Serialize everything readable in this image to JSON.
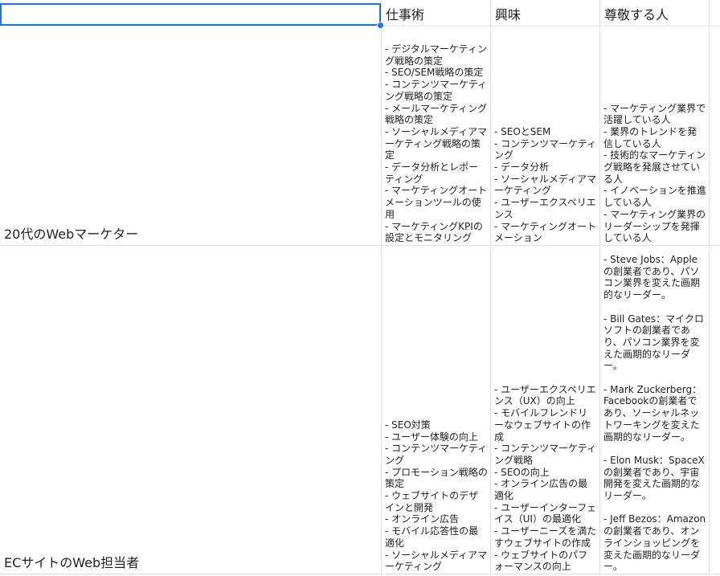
{
  "headers": {
    "a": "",
    "b": "仕事術",
    "c": "興味",
    "d": "尊敬する人"
  },
  "rows": [
    {
      "label": "20代のWebマーケター",
      "b": [
        "- デジタルマーケティング戦略の策定",
        "- SEO/SEM戦略の策定",
        "- コンテンツマーケティング戦略の策定",
        "- メールマーケティング戦略の策定",
        "- ソーシャルメディアマーケティング戦略の策定",
        "- データ分析とレポーティング",
        "- マーケティングオートメーションツールの使用",
        "- マーケティングKPIの設定とモニタリング"
      ],
      "c": [
        "- SEOとSEM",
        "- コンテンツマーケティング",
        "- データ分析",
        "- ソーシャルメディアマーケティング",
        "- ユーザーエクスペリエンス",
        "- マーケティングオートメーション"
      ],
      "d": [
        "- マーケティング業界で活躍している人",
        "- 業界のトレンドを発信している人",
        "- 技術的なマーケティング戦略を発展させている人",
        "- イノベーションを推進している人",
        "- マーケティング業界のリーダーシップを発揮している人"
      ]
    },
    {
      "label": "ECサイトのWeb担当者",
      "b": [
        "- SEO対策",
        "- ユーザー体験の向上",
        "- コンテンツマーケティング",
        "- プロモーション戦略の策定",
        "- ウェブサイトのデザインと開発",
        "- オンライン広告",
        "- モバイル応答性の最適化",
        "- ソーシャルメディアマーケティング"
      ],
      "c": [
        "- ユーザーエクスペリエンス（UX）の向上",
        "- モバイルフレンドリーなウェブサイトの作成",
        "- コンテンツマーケティング戦略",
        "- SEOの向上",
        "- オンライン広告の最適化",
        "- ユーザーインターフェイス（UI）の最適化",
        "- ユーザーニーズを満たすウェブサイトの作成",
        "- ウェブサイトのパフォーマンスの向上"
      ],
      "d": [
        "- Steve Jobs：Appleの創業者であり、パソコン業界を変えた画期的なリーダー。",
        "",
        "- Bill Gates：マイクロソフトの創業者であり、パソコン業界を変えた画期的なリーダー。",
        "",
        "- Mark Zuckerberg：Facebookの創業者であり、ソーシャルネットワーキングを変えた画期的なリーダー。",
        "",
        "- Elon Musk：SpaceXの創業者であり、宇宙開発を変えた画期的なリーダー。",
        "",
        "- Jeff Bezos：Amazonの創業者であり、オンラインショッピングを変えた画期的なリーダー。"
      ]
    }
  ]
}
